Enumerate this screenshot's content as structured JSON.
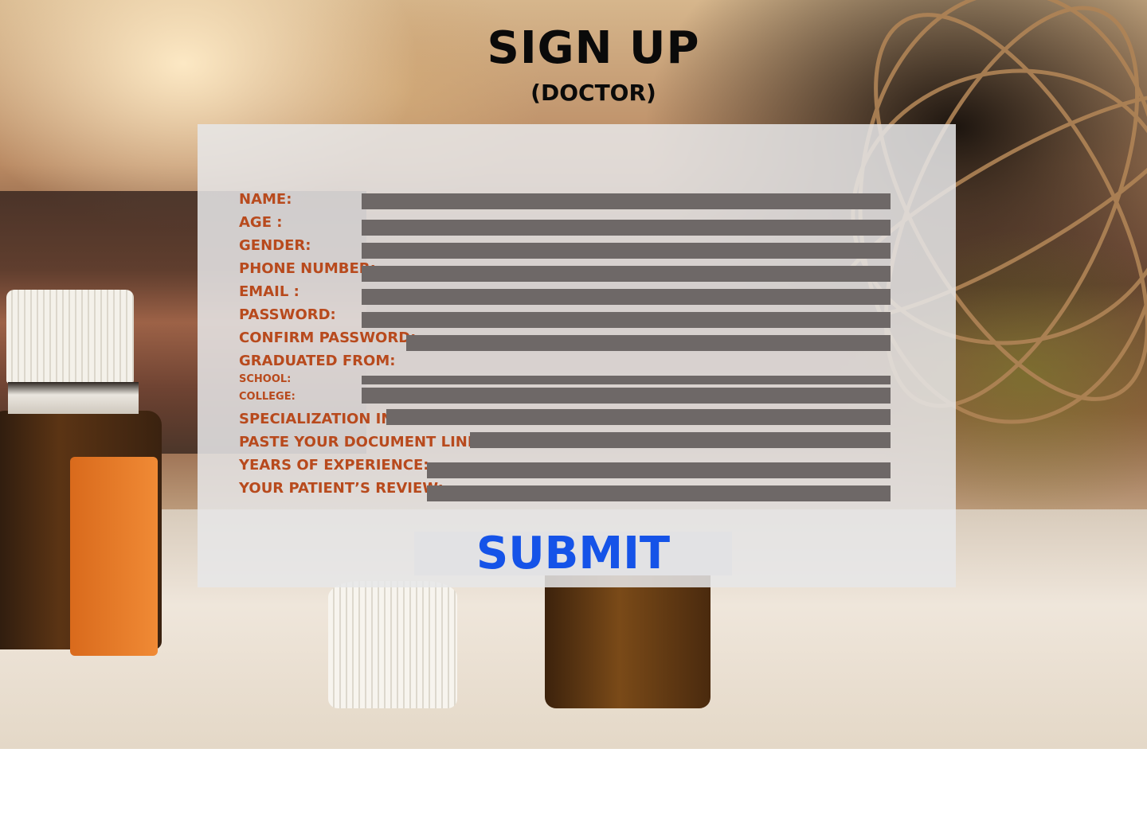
{
  "header": {
    "title": "SIGN UP",
    "subtitle": "(DOCTOR)"
  },
  "form": {
    "name_label": "NAME:",
    "age_label": "AGE    :",
    "gender_label": "GENDER:",
    "phone_label": "PHONE NUMBER:",
    "email_label": "EMAIL  :",
    "password_label": "PASSWORD:",
    "confirm_password_label": "CONFIRM PASSWORD:",
    "graduated_label": "GRADUATED FROM:",
    "school_label": "SCHOOL:",
    "college_label": "COLLEGE:",
    "specialization_label": "SPECIALIZATION IN:",
    "document_label": "PASTE YOUR DOCUMENT LINK:",
    "experience_label": "YEARS OF EXPERIENCE:",
    "review_label": "YOUR PATIENT’S REVIEW:",
    "submit_label": "SUBMIT"
  },
  "colors": {
    "label": "#b84a1d",
    "field": "#6e6867",
    "submit_text": "#1553e8",
    "panel": "#e6e6e8"
  }
}
